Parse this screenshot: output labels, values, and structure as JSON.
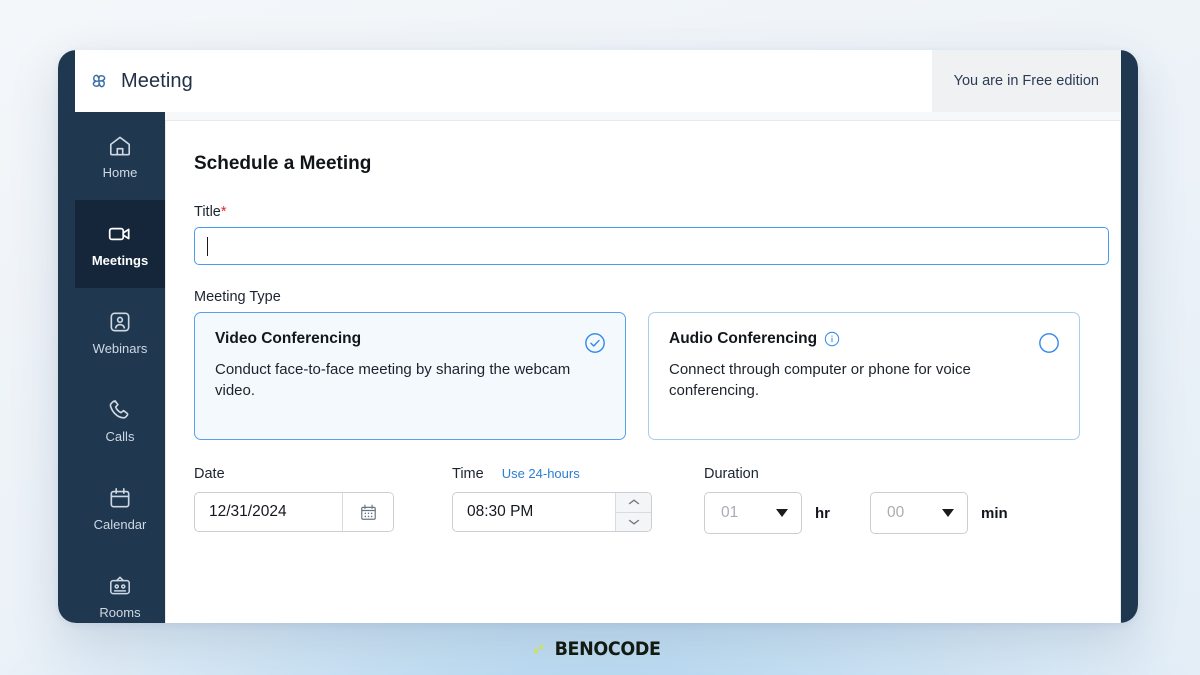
{
  "header": {
    "brand_name": "Meeting",
    "brand_icon": "flower-logo-icon",
    "edition_notice": "You are in Free edition"
  },
  "sidebar": {
    "items": [
      {
        "label": "Home",
        "icon": "home-icon",
        "active": false
      },
      {
        "label": "Meetings",
        "icon": "video-icon",
        "active": true
      },
      {
        "label": "Webinars",
        "icon": "webinar-icon",
        "active": false
      },
      {
        "label": "Calls",
        "icon": "phone-icon",
        "active": false
      },
      {
        "label": "Calendar",
        "icon": "calendar-icon",
        "active": false
      },
      {
        "label": "Rooms",
        "icon": "rooms-icon",
        "active": false
      }
    ]
  },
  "main": {
    "page_title": "Schedule a Meeting",
    "title_field": {
      "label": "Title",
      "required_marker": "*",
      "value": "",
      "placeholder": ""
    },
    "meeting_type": {
      "label": "Meeting Type",
      "options": [
        {
          "title": "Video Conferencing",
          "description": "Conduct face-to-face meeting by sharing the webcam video.",
          "selected": true,
          "marker_icon": "check-circle-icon",
          "has_info_icon": false
        },
        {
          "title": "Audio Conferencing",
          "description": "Connect through computer or phone for voice conferencing.",
          "selected": false,
          "marker_icon": "radio-empty-icon",
          "has_info_icon": true,
          "info_icon": "info-circle-icon"
        }
      ]
    },
    "date": {
      "label": "Date",
      "value": "12/31/2024",
      "picker_icon": "calendar-picker-icon"
    },
    "time": {
      "label": "Time",
      "value": "08:30 PM",
      "toggle_link": "Use 24-hours",
      "spinner_up_icon": "chevron-up-icon",
      "spinner_down_icon": "chevron-down-icon"
    },
    "duration": {
      "label": "Duration",
      "hours_value": "01",
      "hours_unit": "hr",
      "minutes_value": "00",
      "minutes_unit": "min",
      "caret_icon": "dropdown-caret-icon"
    }
  },
  "footer": {
    "brand_text": "BENOCODE",
    "brand_dot_icon": "benocode-dot-icon"
  },
  "colors": {
    "sidebar_navy": "#1f3850",
    "sidebar_active": "#16263a",
    "accent_blue": "#2a7fd4",
    "focus_blue": "#4c9bec",
    "card_selected_bg": "#f4f9fe",
    "required_red": "#e0252b",
    "brand_dot_green": "#c9e265"
  }
}
